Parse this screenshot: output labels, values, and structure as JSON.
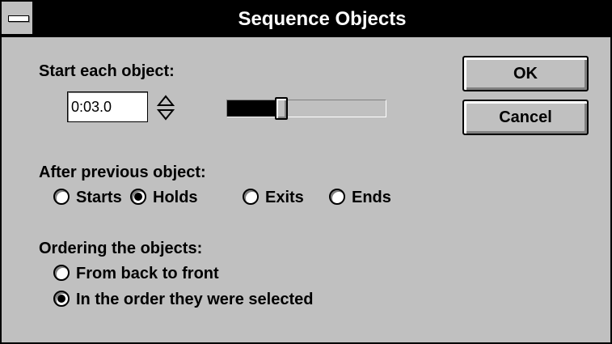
{
  "window": {
    "title": "Sequence Objects"
  },
  "start": {
    "label": "Start each object:",
    "time_value": "0:03.0",
    "slider_level": 0.33
  },
  "buttons": {
    "ok_label": "OK",
    "cancel_label": "Cancel"
  },
  "after": {
    "label": "After previous object:",
    "options": [
      {
        "label": "Starts",
        "selected": false
      },
      {
        "label": "Holds",
        "selected": true
      },
      {
        "label": "Exits",
        "selected": false
      },
      {
        "label": "Ends",
        "selected": false
      }
    ]
  },
  "ordering": {
    "label": "Ordering the objects:",
    "options": [
      {
        "label": "From back to front",
        "selected": false
      },
      {
        "label": "In the order they were selected",
        "selected": true
      }
    ]
  }
}
